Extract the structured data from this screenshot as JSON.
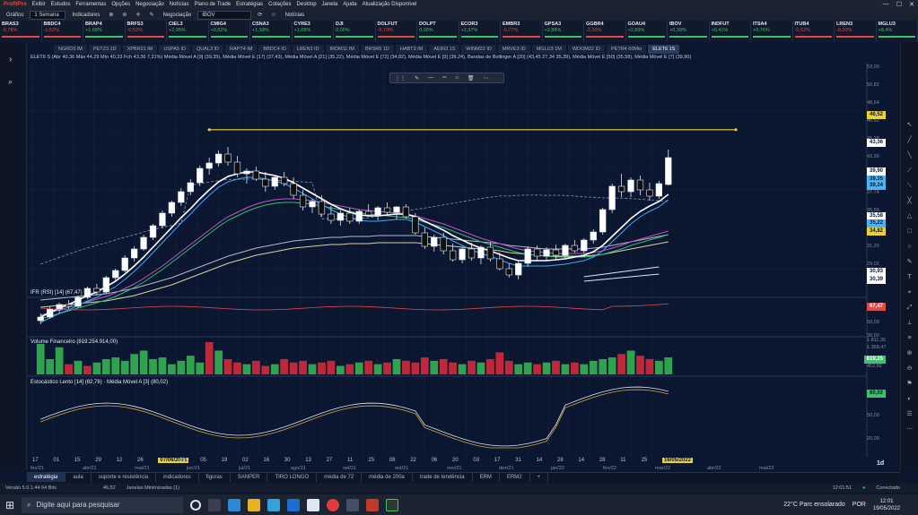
{
  "titlebar": {
    "app": "ProfitPro",
    "menu": [
      "Exibir",
      "Estudos",
      "Ferramentas",
      "Opções",
      "Negociação",
      "Notícias",
      "Plano de Trade",
      "Estratégias",
      "Cotações",
      "Desktop",
      "Janela",
      "Ajuda",
      "Atualização Disponível"
    ]
  },
  "toolbar": {
    "chart_label": "Gráfico",
    "period": "1 Semana",
    "indicators": "Indicadores",
    "negociacao": "Negociação",
    "symbol": "IBOV",
    "news": "Notícias"
  },
  "tickers": [
    {
      "sym": "BRAS3",
      "chg": "-6,78%",
      "dir": "dn"
    },
    {
      "sym": "BBDC4",
      "chg": "-1,52%",
      "dir": "dn"
    },
    {
      "sym": "BRAP4",
      "chg": "+1,68%",
      "dir": "up"
    },
    {
      "sym": "BRFS3",
      "chg": "-0,52%",
      "dir": "dn"
    },
    {
      "sym": "CIEL3",
      "chg": "+2,95%",
      "dir": "up"
    },
    {
      "sym": "CMIG4",
      "chg": "+0,82%",
      "dir": "up"
    },
    {
      "sym": "CSNA3",
      "chg": "+1,58%",
      "dir": "up"
    },
    {
      "sym": "CYRE3",
      "chg": "+1,68%",
      "dir": "up"
    },
    {
      "sym": "DJI",
      "chg": "0,00%",
      "dir": "up"
    },
    {
      "sym": "DOLFUT",
      "chg": "-0,79%",
      "dir": "dn"
    },
    {
      "sym": "DOLPT",
      "chg": "0,00%",
      "dir": "up"
    },
    {
      "sym": "ECOR3",
      "chg": "+2,37%",
      "dir": "up"
    },
    {
      "sym": "EMBR3",
      "chg": "-0,77%",
      "dir": "dn"
    },
    {
      "sym": "GPSA3",
      "chg": "+2,88%",
      "dir": "up"
    },
    {
      "sym": "GGBR4",
      "chg": "-2,20%",
      "dir": "dn"
    },
    {
      "sym": "GOAU4",
      "chg": "+2,89%",
      "dir": "up"
    },
    {
      "sym": "IBOV",
      "chg": "+0,39%",
      "dir": "up"
    },
    {
      "sym": "INDFUT",
      "chg": "+0,41%",
      "dir": "up"
    },
    {
      "sym": "ITSA4",
      "chg": "+0,76%",
      "dir": "up"
    },
    {
      "sym": "ITUB4",
      "chg": "-0,52%",
      "dir": "dn"
    },
    {
      "sym": "LREN3",
      "chg": "-0,20%",
      "dir": "dn"
    },
    {
      "sym": "MGLU3",
      "chg": "+8,4%",
      "dir": "up"
    }
  ],
  "chart_tabs": [
    "NGRD3 IM",
    "PETZ3 1D",
    "XPBR31 IM",
    "USPA5 ID",
    "QUAL3 ID",
    "RAPT4 IM",
    "BBDC4 ID",
    "LREN3 ID",
    "IRDM11 IM",
    "BRSR6 1D",
    "HABT3 IM",
    "AERI3 1S",
    "WINM22 ID",
    "MRVE3 ID",
    "MGLU3 1M",
    "WDOM22 ID",
    "PETR4 60Min",
    "ELET6 1S"
  ],
  "info_line": "ELET6 S (Abr 40,36 Máx 44,29 Mín 40,33 Fch 43,36 7,31%)  Média Móvel A [9] (39,35), Média Móvel E [17] (37,43), Média Móvel A [21] (35,22), Média Móvel E [72] (34,82), Média Móvel E [9] (39,24), Bandas de Bollinger A [20] (43,45 27,34 35,39), Média Móvel E [50] (35,58), Média Móvel E [7] (39,90)",
  "price_tags": [
    {
      "label": "46,52",
      "color": "#e8d23a"
    },
    {
      "label": "43,36",
      "color": "#ffffff"
    },
    {
      "label": "39,90",
      "color": "#ffffff"
    },
    {
      "label": "39,35",
      "color": "#4fb4f0"
    },
    {
      "label": "39,24",
      "color": "#4fb4f0"
    },
    {
      "label": "35,58",
      "color": "#ffffff"
    },
    {
      "label": "35,22",
      "color": "#4fb4f0"
    },
    {
      "label": "34,82",
      "color": "#e8d23a"
    },
    {
      "label": "30,93",
      "color": "#ffffff"
    },
    {
      "label": "30,39",
      "color": "#ffffff"
    }
  ],
  "price_axis": [
    "53,00",
    "50,82",
    "48,64",
    "46,52",
    "45,28",
    "43,36",
    "42,10",
    "37,74",
    "35,56",
    "33,38",
    "31,20",
    "29,02"
  ],
  "rsi": {
    "title": "IFR (RSI) [14] (67,47)",
    "value": "67,47",
    "axis": [
      "50,00",
      "30,00"
    ]
  },
  "volume": {
    "title": "Volume Financeiro (819.254.914,00)",
    "value": "819,25",
    "axis": [
      "1.811,35",
      "1.368,47",
      "452,82"
    ]
  },
  "stoch": {
    "title": "Estocástico Lento [14] (82,76) · Média Móvel A [3] (80,02)",
    "value": "80,02",
    "axis": [
      "50,00",
      "20,00"
    ]
  },
  "dates": [
    "17",
    "01",
    "15",
    "29",
    "12",
    "26",
    "07/06/2021",
    "21",
    "05",
    "19",
    "02",
    "16",
    "30",
    "13",
    "27",
    "11",
    "25",
    "08",
    "22",
    "06",
    "20",
    "03",
    "17",
    "31",
    "14",
    "28",
    "14",
    "28",
    "11",
    "25",
    "16/05/2022"
  ],
  "months": [
    "fev/21",
    "abr/21",
    "mai/21",
    "jun/21",
    "jul/21",
    "ago/21",
    "set/21",
    "out/21",
    "nov/21",
    "dez/21",
    "jan/22",
    "fev/22",
    "mar/22",
    "abr/22",
    "mai/22"
  ],
  "zoom": "1d",
  "bottom_tabs": [
    "estratégia",
    "aula",
    "suporte e resistência",
    "indicadores",
    "figuras",
    "SANPER",
    "TIRO LONGO",
    "média de 72",
    "média de 200a",
    "trade de tendência",
    "ERM",
    "ERM2"
  ],
  "status": {
    "version": "Versão 5.0.1.44 64 Bits",
    "field": "46,52",
    "alert": "Janelas Minimizadas (1)",
    "time": "12:01:51",
    "conn": "Conectado"
  },
  "taskbar": {
    "search": "Digite aqui para pesquisar",
    "weather": "22°C  Parc ensolarado",
    "lang": "POR",
    "clock": "12:01",
    "date": "19/05/2022"
  },
  "chart_data": {
    "type": "candlestick",
    "title": "ELET6 1S",
    "candles": [
      [
        25.2,
        26.0,
        24.8,
        25.6
      ],
      [
        25.6,
        26.8,
        25.4,
        26.5
      ],
      [
        26.4,
        27.2,
        26.0,
        27.0
      ],
      [
        27.0,
        27.5,
        26.5,
        26.8
      ],
      [
        26.8,
        28.0,
        26.6,
        27.8
      ],
      [
        27.8,
        29.0,
        27.6,
        28.8
      ],
      [
        28.8,
        29.3,
        28.0,
        28.4
      ],
      [
        28.4,
        30.2,
        28.2,
        30.0
      ],
      [
        30.0,
        31.0,
        29.6,
        30.8
      ],
      [
        30.8,
        32.5,
        30.6,
        32.2
      ],
      [
        32.2,
        33.5,
        31.8,
        33.2
      ],
      [
        33.2,
        34.8,
        33.0,
        34.5
      ],
      [
        34.5,
        36.0,
        34.2,
        35.8
      ],
      [
        35.8,
        37.5,
        35.5,
        37.2
      ],
      [
        37.2,
        38.6,
        36.8,
        38.4
      ],
      [
        38.4,
        40.0,
        38.0,
        39.6
      ],
      [
        39.6,
        41.0,
        39.2,
        40.6
      ],
      [
        40.6,
        42.5,
        40.2,
        42.2
      ],
      [
        42.2,
        43.4,
        41.5,
        42.8
      ],
      [
        42.8,
        44.2,
        42.4,
        43.8
      ],
      [
        43.8,
        44.6,
        42.5,
        42.9
      ],
      [
        42.9,
        43.6,
        41.2,
        41.6
      ],
      [
        41.6,
        42.2,
        40.5,
        41.9
      ],
      [
        41.9,
        42.4,
        40.8,
        41.0
      ],
      [
        41.0,
        41.8,
        39.6,
        40.2
      ],
      [
        40.2,
        41.5,
        39.8,
        41.2
      ],
      [
        41.2,
        41.8,
        40.2,
        40.5
      ],
      [
        40.5,
        41.2,
        38.8,
        39.2
      ],
      [
        39.2,
        39.8,
        37.5,
        37.9
      ],
      [
        37.9,
        38.8,
        37.2,
        38.5
      ],
      [
        38.5,
        39.2,
        36.8,
        37.1
      ],
      [
        37.1,
        38.0,
        36.0,
        36.4
      ],
      [
        36.4,
        37.5,
        35.8,
        37.2
      ],
      [
        37.2,
        37.8,
        36.0,
        36.3
      ],
      [
        36.3,
        37.6,
        36.0,
        37.4
      ],
      [
        37.4,
        38.2,
        36.8,
        37.0
      ],
      [
        37.0,
        38.0,
        36.4,
        37.8
      ],
      [
        37.8,
        38.4,
        37.0,
        37.3
      ],
      [
        37.3,
        38.0,
        36.5,
        37.9
      ],
      [
        37.9,
        38.2,
        36.6,
        36.8
      ],
      [
        36.8,
        37.2,
        34.8,
        35.0
      ],
      [
        35.0,
        35.6,
        33.2,
        33.5
      ],
      [
        33.5,
        34.8,
        32.9,
        34.5
      ],
      [
        34.5,
        35.0,
        32.6,
        33.0
      ],
      [
        33.0,
        33.8,
        31.8,
        32.0
      ],
      [
        32.0,
        33.4,
        31.6,
        33.2
      ],
      [
        33.2,
        33.9,
        31.9,
        32.2
      ],
      [
        32.2,
        33.6,
        31.5,
        33.4
      ],
      [
        33.4,
        34.0,
        31.8,
        32.1
      ],
      [
        32.1,
        32.8,
        30.8,
        31.0
      ],
      [
        31.0,
        31.6,
        30.0,
        30.3
      ],
      [
        30.3,
        31.8,
        29.8,
        31.6
      ],
      [
        31.6,
        33.5,
        31.2,
        33.2
      ],
      [
        33.2,
        33.6,
        31.9,
        32.4
      ],
      [
        32.4,
        33.4,
        31.9,
        33.1
      ],
      [
        33.1,
        33.7,
        32.1,
        32.5
      ],
      [
        32.5,
        33.8,
        32.2,
        33.6
      ],
      [
        33.6,
        34.2,
        32.8,
        33.0
      ],
      [
        33.0,
        34.4,
        32.7,
        34.2
      ],
      [
        34.2,
        35.4,
        33.8,
        35.1
      ],
      [
        35.1,
        37.8,
        34.8,
        37.6
      ],
      [
        37.6,
        40.5,
        37.2,
        40.2
      ],
      [
        40.2,
        41.6,
        39.0,
        39.6
      ],
      [
        39.6,
        41.2,
        39.0,
        40.9
      ],
      [
        40.9,
        41.4,
        39.2,
        39.8
      ],
      [
        39.8,
        40.6,
        38.6,
        39.1
      ],
      [
        39.1,
        40.8,
        38.8,
        40.5
      ],
      [
        40.4,
        44.3,
        40.3,
        43.4
      ]
    ],
    "ma_fast": [
      25.6,
      26.1,
      26.6,
      27.0,
      27.5,
      28.0,
      28.4,
      29.0,
      29.6,
      30.4,
      31.3,
      32.3,
      33.4,
      34.5,
      35.6,
      36.7,
      37.7,
      38.8,
      39.8,
      40.7,
      41.3,
      41.6,
      41.8,
      41.8,
      41.6,
      41.4,
      41.1,
      40.6,
      40.0,
      39.4,
      38.8,
      38.2,
      37.7,
      37.3,
      37.0,
      36.9,
      36.9,
      37.0,
      37.1,
      37.1,
      36.8,
      36.3,
      35.8,
      35.3,
      34.7,
      34.2,
      33.7,
      33.3,
      33.0,
      32.6,
      32.2,
      31.9,
      31.9,
      31.9,
      31.9,
      32.0,
      32.1,
      32.3,
      32.5,
      32.9,
      33.6,
      34.6,
      35.6,
      36.6,
      37.4,
      38.0,
      38.5,
      39.3
    ],
    "ma_mid": [
      25.8,
      26.1,
      26.4,
      26.7,
      27.0,
      27.3,
      27.6,
      27.9,
      28.3,
      28.8,
      29.3,
      29.9,
      30.6,
      31.3,
      32.1,
      32.9,
      33.7,
      34.5,
      35.3,
      36.1,
      36.8,
      37.3,
      37.8,
      38.2,
      38.5,
      38.7,
      38.8,
      38.8,
      38.7,
      38.6,
      38.4,
      38.2,
      38.0,
      37.8,
      37.6,
      37.5,
      37.4,
      37.3,
      37.2,
      37.1,
      36.9,
      36.6,
      36.3,
      36.0,
      35.6,
      35.2,
      34.8,
      34.4,
      34.1,
      33.8,
      33.5,
      33.2,
      33.0,
      32.9,
      32.8,
      32.7,
      32.7,
      32.7,
      32.7,
      32.8,
      33.0,
      33.3,
      33.6,
      34.0,
      34.3,
      34.6,
      34.9,
      35.2
    ],
    "ma_slow": [
      27.5,
      27.6,
      27.7,
      27.8,
      27.9,
      28.0,
      28.1,
      28.2,
      28.4,
      28.6,
      28.8,
      29.1,
      29.4,
      29.7,
      30.0,
      30.4,
      30.8,
      31.2,
      31.6,
      32.0,
      32.4,
      32.7,
      33.0,
      33.3,
      33.5,
      33.7,
      33.9,
      34.1,
      34.2,
      34.3,
      34.4,
      34.5,
      34.5,
      34.6,
      34.6,
      34.6,
      34.7,
      34.7,
      34.7,
      34.7,
      34.7,
      34.6,
      34.5,
      34.4,
      34.3,
      34.2,
      34.1,
      34.0,
      33.9,
      33.8,
      33.6,
      33.5,
      33.4,
      33.3,
      33.2,
      33.2,
      33.2,
      33.2,
      33.2,
      33.3,
      33.4,
      33.6,
      33.8,
      34.0,
      34.2,
      34.4,
      34.6,
      34.8
    ],
    "resistance": 46.52,
    "ylim": [
      29.0,
      53.0
    ],
    "volume": [
      1.8,
      0.9,
      1.6,
      0.6,
      0.8,
      0.5,
      0.7,
      0.9,
      1.0,
      0.8,
      1.2,
      1.4,
      0.9,
      1.0,
      0.6,
      0.8,
      1.1,
      0.7,
      1.9,
      1.4,
      0.9,
      0.7,
      0.6,
      0.8,
      0.5,
      0.6,
      0.9,
      0.7,
      0.8,
      0.6,
      0.7,
      0.8,
      0.5,
      0.6,
      0.7,
      0.8,
      0.6,
      0.7,
      0.9,
      0.8,
      0.7,
      1.0,
      0.8,
      0.9,
      0.7,
      0.6,
      0.8,
      0.7,
      0.9,
      1.3,
      0.8,
      0.6,
      0.7,
      0.6,
      0.7,
      0.8,
      0.6,
      0.7,
      0.6,
      0.8,
      0.9,
      1.0,
      1.2,
      1.4,
      1.1,
      0.9,
      0.8,
      1.0
    ],
    "volume_up": [
      1,
      1,
      1,
      0,
      1,
      0,
      1,
      1,
      1,
      1,
      1,
      1,
      1,
      1,
      1,
      1,
      1,
      1,
      0,
      1,
      0,
      0,
      1,
      0,
      0,
      1,
      0,
      0,
      0,
      1,
      0,
      0,
      1,
      0,
      1,
      0,
      1,
      0,
      1,
      0,
      0,
      0,
      1,
      0,
      0,
      1,
      0,
      1,
      0,
      0,
      0,
      1,
      1,
      0,
      1,
      0,
      1,
      0,
      1,
      1,
      1,
      1,
      0,
      1,
      0,
      0,
      1,
      1
    ]
  }
}
